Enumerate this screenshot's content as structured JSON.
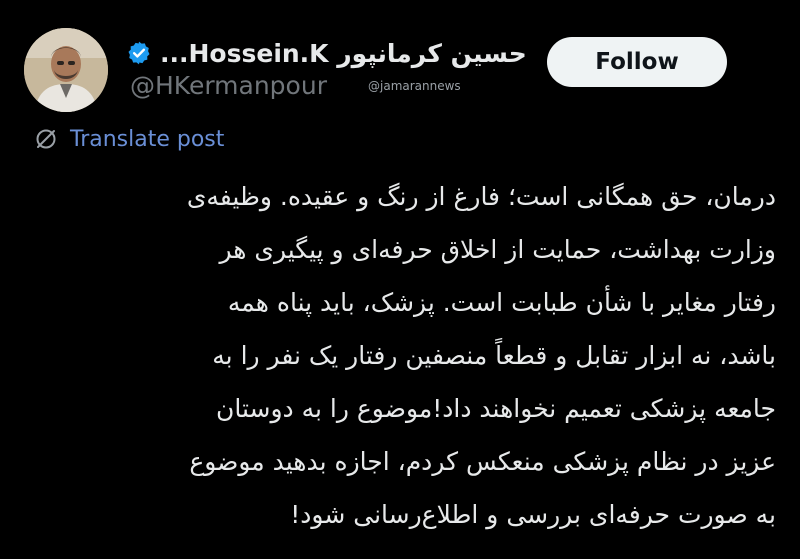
{
  "profile": {
    "display_name": "حسین کرمانپور Hossein.K...",
    "handle": "@HKermanpour",
    "verified": true,
    "watermark": "@jamarannews"
  },
  "follow_button": {
    "label": "Follow"
  },
  "translate": {
    "label": "Translate post"
  },
  "post": {
    "lines": [
      "درمان، حق همگانی است؛ فارغ از رنگ و عقیده. وظیفه‌ی",
      "وزارت بهداشت، حمایت از اخلاق حرفه‌ای و پیگیری هر",
      "رفتار مغایر با شأن طبابت است. پزشک، باید پناه همه",
      "باشد، نه ابزار تقابل و قطعاً منصفین رفتار یک نفر را به",
      "جامعه پزشکی تعمیم نخواهند داد!موضوع را به دوستان",
      "عزیز در نظام پزشکی منعکس کردم، اجازه بدهید موضوع",
      "به صورت حرفه‌ای بررسی و اطلاع‌رسانی شود!"
    ]
  },
  "colors": {
    "background": "#000000",
    "text": "#e7e9ea",
    "muted": "#71767b",
    "link": "#6a8fd6",
    "verified_badge": "#1d9bf0",
    "button_bg": "#eff3f4"
  },
  "icons": {
    "verified": "verified-badge-icon",
    "translate": "globe-slash-icon"
  }
}
